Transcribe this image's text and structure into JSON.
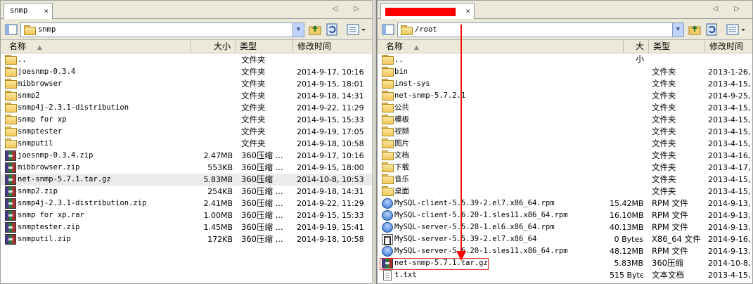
{
  "left": {
    "tab_title": "snmp",
    "tab_close": "×",
    "nav_arrows": "◁ ▷",
    "path": "snmp",
    "columns": {
      "name": "名称",
      "size": "大小",
      "type": "类型",
      "mtime": "修改时间"
    },
    "files": [
      {
        "icon": "folder",
        "name": "..",
        "size": "",
        "type": "文件夹",
        "mtime": ""
      },
      {
        "icon": "folder",
        "name": "joesnmp-0.3.4",
        "size": "",
        "type": "文件夹",
        "mtime": "2014-9-17, 10:16"
      },
      {
        "icon": "folder",
        "name": "mibbrowser",
        "size": "",
        "type": "文件夹",
        "mtime": "2014-9-15, 18:01"
      },
      {
        "icon": "folder",
        "name": "snmp2",
        "size": "",
        "type": "文件夹",
        "mtime": "2014-9-18, 14:31"
      },
      {
        "icon": "folder",
        "name": "snmp4j-2.3.1-distribution",
        "size": "",
        "type": "文件夹",
        "mtime": "2014-9-22, 11:29"
      },
      {
        "icon": "folder",
        "name": "snmp for xp",
        "size": "",
        "type": "文件夹",
        "mtime": "2014-9-15, 15:33"
      },
      {
        "icon": "folder",
        "name": "snmptester",
        "size": "",
        "type": "文件夹",
        "mtime": "2014-9-19, 17:05"
      },
      {
        "icon": "folder",
        "name": "snmputil",
        "size": "",
        "type": "文件夹",
        "mtime": "2014-9-18, 10:58"
      },
      {
        "icon": "zip",
        "name": "joesnmp-0.3.4.zip",
        "size": "2.47MB",
        "type": "360压缩 ...",
        "mtime": "2014-9-17, 10:16"
      },
      {
        "icon": "zip",
        "name": "mibbrowser.zip",
        "size": "553KB",
        "type": "360压缩 ...",
        "mtime": "2014-9-15, 18:00"
      },
      {
        "icon": "zip",
        "name": "net-snmp-5.7.1.tar.gz",
        "size": "5.83MB",
        "type": "360压缩",
        "mtime": "2014-10-8, 10:53"
      },
      {
        "icon": "zip",
        "name": "snmp2.zip",
        "size": "254KB",
        "type": "360压缩 ...",
        "mtime": "2014-9-18, 14:31"
      },
      {
        "icon": "zip",
        "name": "snmp4j-2.3.1-distribution.zip",
        "size": "2.41MB",
        "type": "360压缩 ...",
        "mtime": "2014-9-22, 11:29"
      },
      {
        "icon": "zip",
        "name": "snmp for xp.rar",
        "size": "1.00MB",
        "type": "360压缩 ...",
        "mtime": "2014-9-15, 15:33"
      },
      {
        "icon": "zip",
        "name": "snmptester.zip",
        "size": "1.45MB",
        "type": "360压缩 ...",
        "mtime": "2014-9-19, 15:41"
      },
      {
        "icon": "zip",
        "name": "snmputil.zip",
        "size": "172KB",
        "type": "360压缩 ...",
        "mtime": "2014-9-18, 10:58"
      }
    ]
  },
  "right": {
    "tab_close": "×",
    "nav_arrows": "◁ ▷",
    "path": "/root",
    "columns": {
      "name": "名称",
      "size": "大小",
      "type": "类型",
      "mtime": "修改时间"
    },
    "files": [
      {
        "icon": "folder",
        "name": "..",
        "size": "",
        "type": "",
        "mtime": ""
      },
      {
        "icon": "folder",
        "name": "bin",
        "size": "",
        "type": "文件夹",
        "mtime": "2013-1-26,"
      },
      {
        "icon": "folder",
        "name": "inst-sys",
        "size": "",
        "type": "文件夹",
        "mtime": "2013-4-15,"
      },
      {
        "icon": "folder",
        "name": "net-snmp-5.7.2.1",
        "size": "",
        "type": "文件夹",
        "mtime": "2014-9-25,"
      },
      {
        "icon": "folder",
        "name": "公共",
        "size": "",
        "type": "文件夹",
        "mtime": "2013-4-15,"
      },
      {
        "icon": "folder",
        "name": "模板",
        "size": "",
        "type": "文件夹",
        "mtime": "2013-4-15,"
      },
      {
        "icon": "folder",
        "name": "视频",
        "size": "",
        "type": "文件夹",
        "mtime": "2013-4-15,"
      },
      {
        "icon": "folder",
        "name": "图片",
        "size": "",
        "type": "文件夹",
        "mtime": "2013-4-15,"
      },
      {
        "icon": "folder",
        "name": "文档",
        "size": "",
        "type": "文件夹",
        "mtime": "2013-4-16,"
      },
      {
        "icon": "folder",
        "name": "下载",
        "size": "",
        "type": "文件夹",
        "mtime": "2013-4-17,"
      },
      {
        "icon": "folder",
        "name": "音乐",
        "size": "",
        "type": "文件夹",
        "mtime": "2013-4-15,"
      },
      {
        "icon": "folder",
        "name": "桌面",
        "size": "",
        "type": "文件夹",
        "mtime": "2013-4-15,"
      },
      {
        "icon": "rpm",
        "name": "MySQL-client-5.5.39-2.el7.x86_64.rpm",
        "size": "15.42MB",
        "type": "RPM 文件",
        "mtime": "2014-9-13,"
      },
      {
        "icon": "rpm",
        "name": "MySQL-client-5.6.20-1.sles11.x86_64.rpm",
        "size": "16.10MB",
        "type": "RPM 文件",
        "mtime": "2014-9-13,"
      },
      {
        "icon": "rpm",
        "name": "MySQL-server-5.5.28-1.el6.x86_64.rpm",
        "size": "40.13MB",
        "type": "RPM 文件",
        "mtime": "2014-9-13,"
      },
      {
        "icon": "exe",
        "name": "MySQL-server-5.5.39-2.el7.x86_64",
        "size": "0 Bytes",
        "type": "X86_64 文件",
        "mtime": "2014-9-16,"
      },
      {
        "icon": "rpm",
        "name": "MySQL-server-5.6.20-1.sles11.x86_64.rpm",
        "size": "48.12MB",
        "type": "RPM 文件",
        "mtime": "2014-9-13,"
      },
      {
        "icon": "zip",
        "name": "net-snmp-5.7.1.tar.gz",
        "size": "5.83MB",
        "type": "360压缩",
        "mtime": "2014-10-8,"
      },
      {
        "icon": "txt",
        "name": "t.txt",
        "size": "515 Bytes",
        "type": "文本文档",
        "mtime": "2013-4-15,"
      }
    ]
  },
  "colors": {
    "accent_red": "#ff0000",
    "selection_box": "#e03030"
  }
}
